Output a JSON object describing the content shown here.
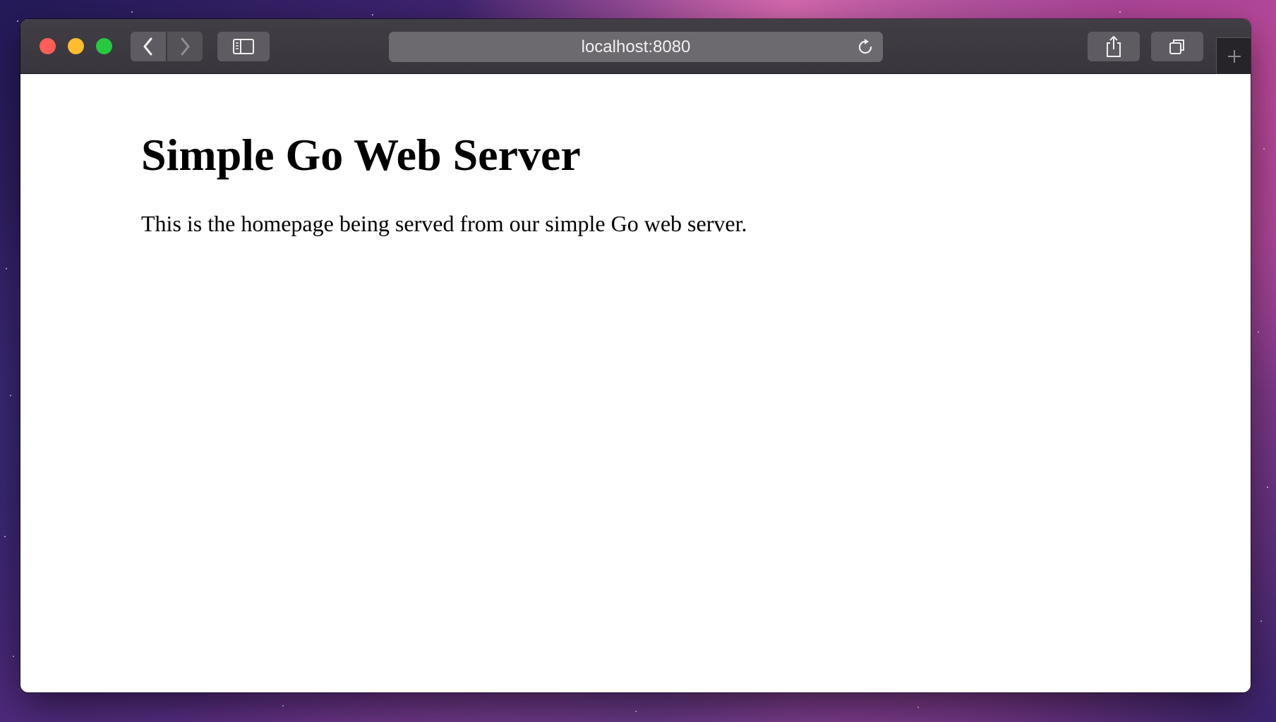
{
  "browser": {
    "address": "localhost:8080",
    "icons": {
      "back": "chevron-left-icon",
      "forward": "chevron-right-icon",
      "sidebar": "sidebar-icon",
      "reload": "reload-icon",
      "share": "share-icon",
      "tabs": "tab-overview-icon",
      "new_tab": "plus-icon"
    }
  },
  "page": {
    "heading": "Simple Go Web Server",
    "body_text": "This is the homepage being served from our simple Go web server."
  },
  "colors": {
    "close": "#fe5f57",
    "minimize": "#febc2e",
    "zoom": "#28c840"
  }
}
